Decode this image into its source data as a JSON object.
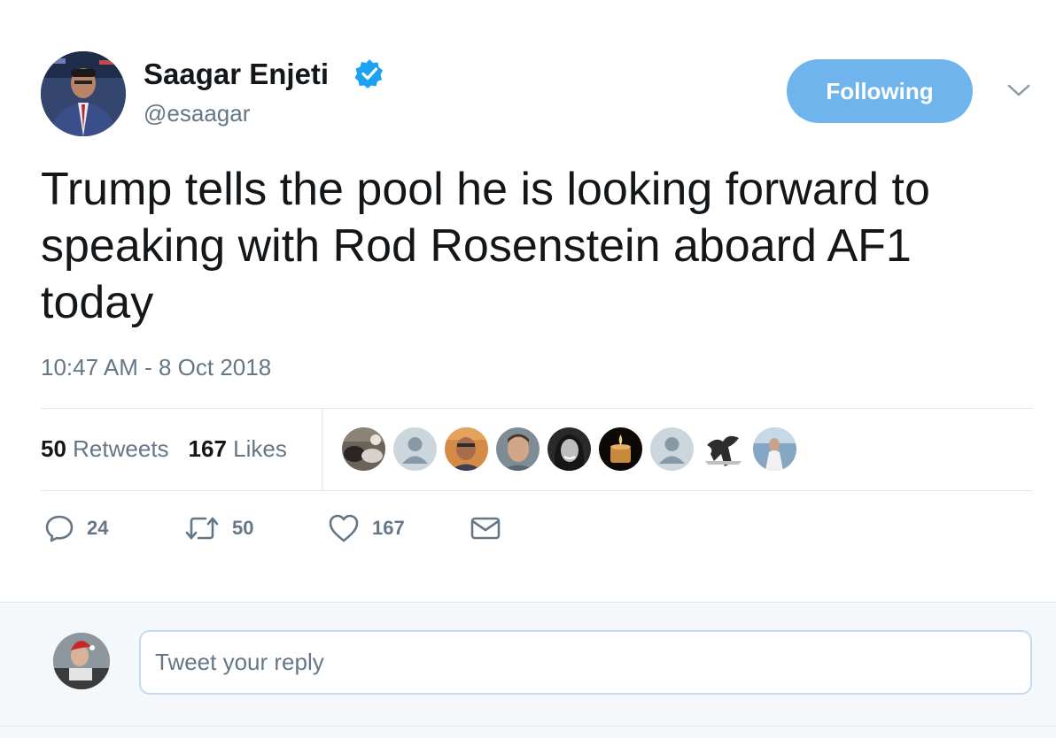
{
  "author": {
    "name": "Saagar Enjeti",
    "handle": "@esaagar",
    "verified": true,
    "avatar_icon": "person-avatar"
  },
  "follow_button": {
    "label": "Following"
  },
  "menu": {
    "icon": "chevron-down-icon"
  },
  "tweet": {
    "text": "Trump tells the pool he is looking forward to speaking with Rod Rosenstein aboard AF1 today",
    "timestamp": "10:47 AM - 8 Oct 2018"
  },
  "stats": {
    "retweets_count": "50",
    "retweets_label": "Retweets",
    "likes_count": "167",
    "likes_label": "Likes"
  },
  "likers": [
    {
      "icon": "liker-avatar"
    },
    {
      "icon": "default-avatar"
    },
    {
      "icon": "liker-avatar"
    },
    {
      "icon": "liker-avatar"
    },
    {
      "icon": "liker-avatar"
    },
    {
      "icon": "candle-avatar"
    },
    {
      "icon": "default-avatar"
    },
    {
      "icon": "liker-avatar"
    },
    {
      "icon": "liker-avatar"
    }
  ],
  "actions": {
    "reply_count": "24",
    "retweet_count": "50",
    "like_count": "167"
  },
  "reply": {
    "placeholder": "Tweet your reply"
  },
  "colors": {
    "follow_button_bg": "#6fb4ec",
    "verified_badge": "#1da1f2",
    "secondary_text": "#657786",
    "primary_text": "#14171a"
  }
}
